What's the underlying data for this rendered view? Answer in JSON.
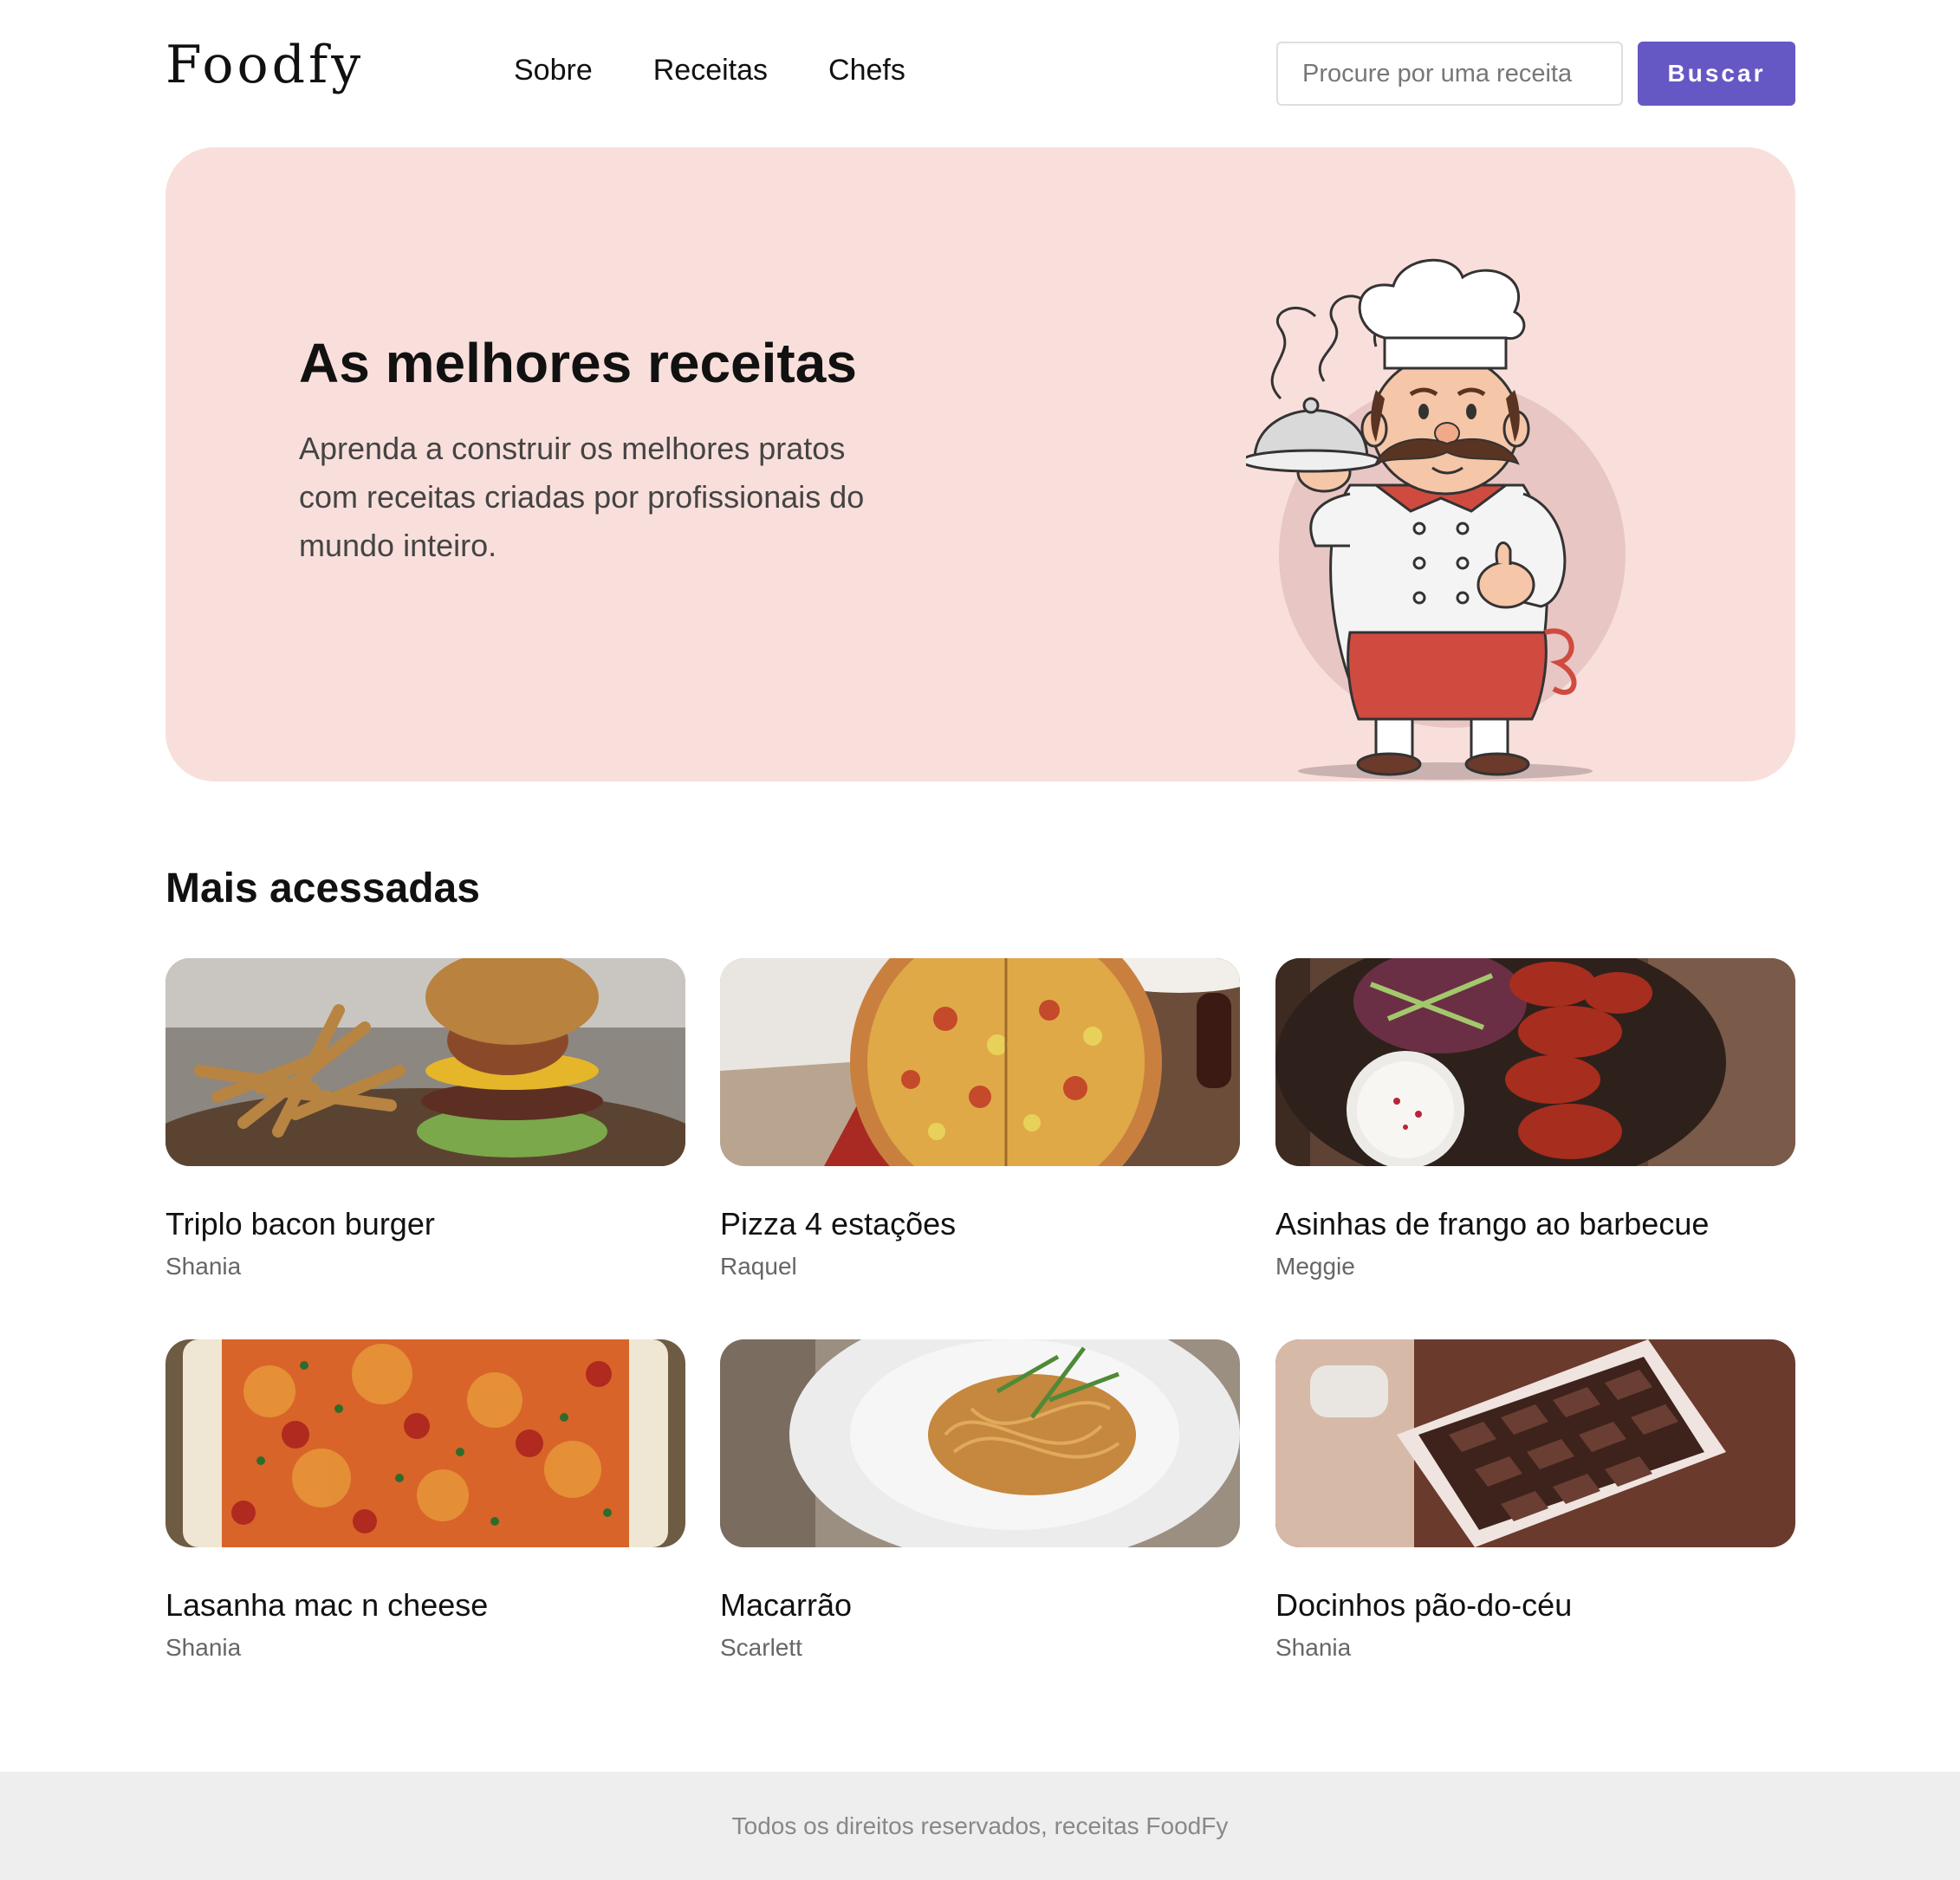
{
  "header": {
    "logo": "Foodfy",
    "nav": [
      "Sobre",
      "Receitas",
      "Chefs"
    ],
    "search_placeholder": "Procure por uma receita",
    "search_button": "Buscar"
  },
  "hero": {
    "title": "As melhores receitas",
    "description": "Aprenda a construir os melhores pratos com receitas criadas por profissionais do mundo inteiro.",
    "image_icon": "chef-illustration"
  },
  "section": {
    "title": "Mais acessadas"
  },
  "recipes": [
    {
      "title": "Triplo bacon burger",
      "author": "Shania"
    },
    {
      "title": "Pizza 4 estações",
      "author": "Raquel"
    },
    {
      "title": "Asinhas de frango ao barbecue",
      "author": "Meggie"
    },
    {
      "title": "Lasanha mac n cheese",
      "author": "Shania"
    },
    {
      "title": "Macarrão",
      "author": "Scarlett"
    },
    {
      "title": "Docinhos pão-do-céu",
      "author": "Shania"
    }
  ],
  "footer": {
    "text": "Todos os direitos reservados, receitas FoodFy"
  },
  "colors": {
    "accent": "#6558c5",
    "hero_bg": "#f9dfdb",
    "footer_bg": "#eeeeee"
  }
}
